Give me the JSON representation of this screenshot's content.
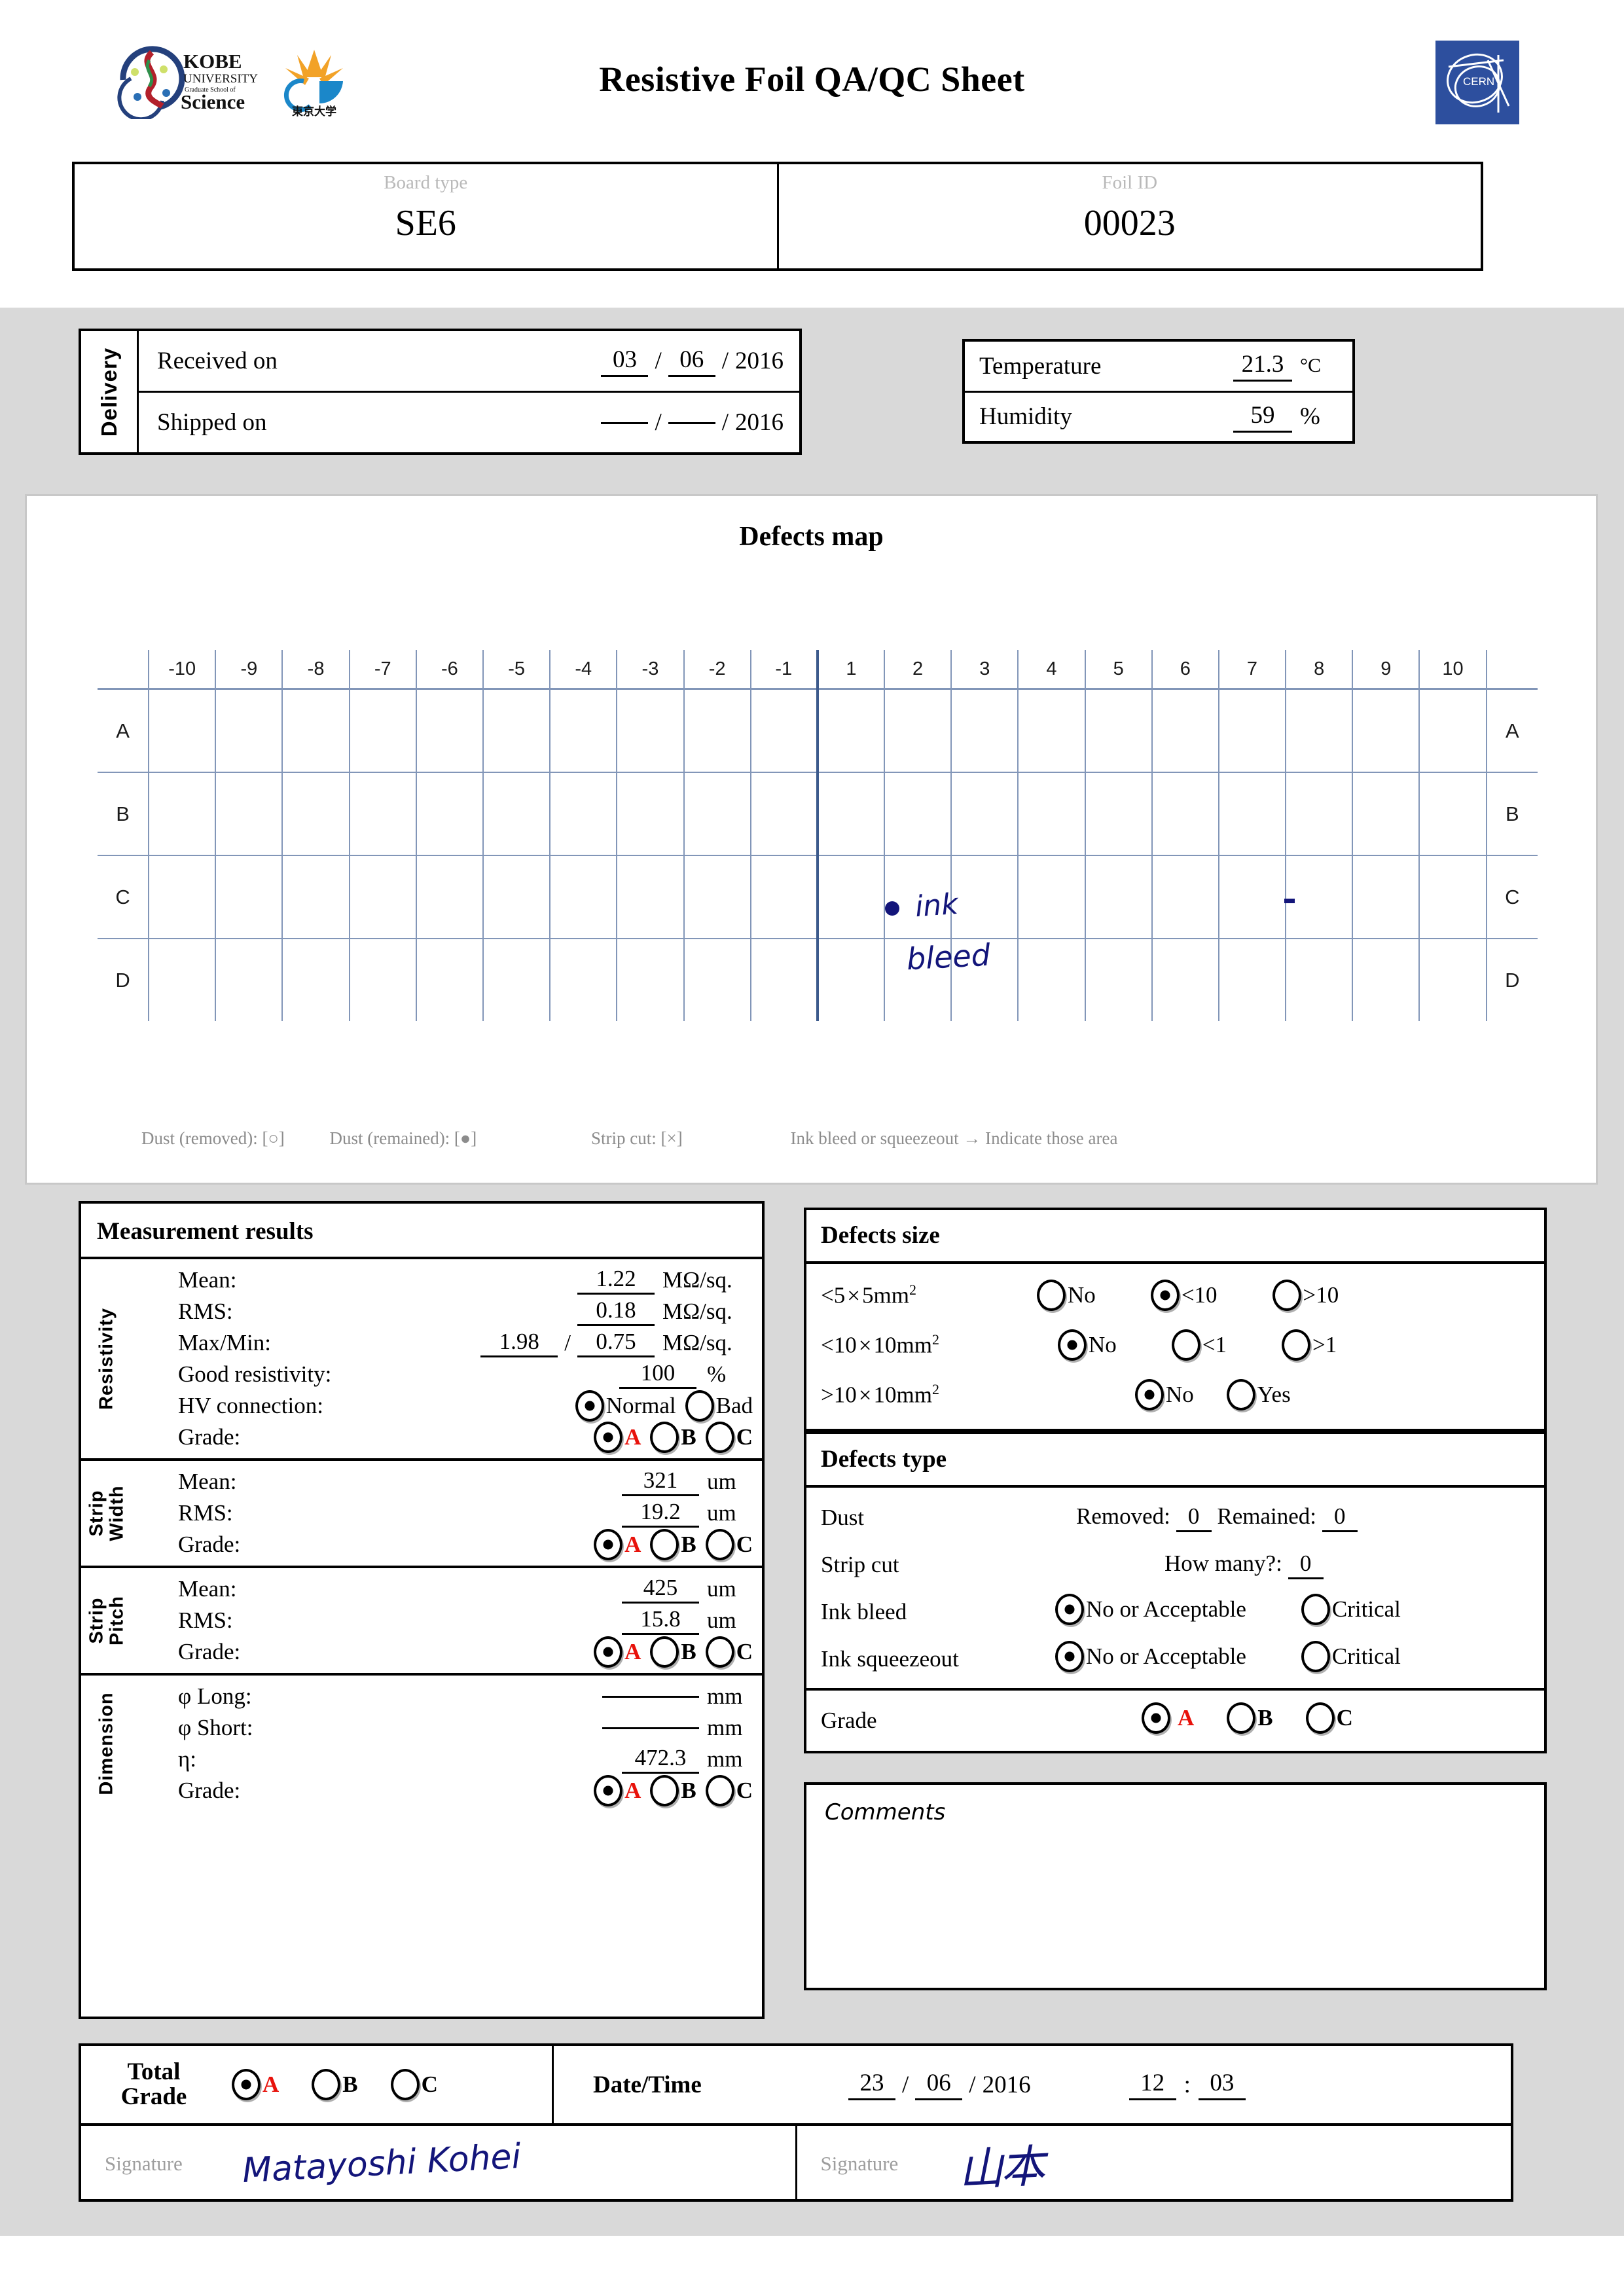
{
  "header": {
    "title": "Resistive Foil QA/QC Sheet",
    "logos": {
      "kobe": "KOBE UNIVERSITY Graduate School of Science",
      "tokyo": "東京大学 THE UNIVERSITY OF TOKYO",
      "cern": "CERN"
    }
  },
  "identity": {
    "board_type_label": "Board type",
    "board_type_value": "SE6",
    "foil_id_label": "Foil ID",
    "foil_id_value": "00023"
  },
  "delivery": {
    "section_label": "Delivery",
    "received_label": "Received on",
    "received_day": "03",
    "received_month": "06",
    "received_year": "2016",
    "shipped_label": "Shipped on",
    "shipped_day": "",
    "shipped_month": "",
    "shipped_year": "2016"
  },
  "environment": {
    "temperature_label": "Temperature",
    "temperature_value": "21.3",
    "temperature_unit": "°C",
    "humidity_label": "Humidity",
    "humidity_value": "59",
    "humidity_unit": "%"
  },
  "defects_map": {
    "title": "Defects map",
    "columns": [
      "-10",
      "-9",
      "-8",
      "-7",
      "-6",
      "-5",
      "-4",
      "-3",
      "-2",
      "-1",
      "1",
      "2",
      "3",
      "4",
      "5",
      "6",
      "7",
      "8",
      "9",
      "10"
    ],
    "rows": [
      "A",
      "B",
      "C",
      "D"
    ],
    "annotations": [
      {
        "type": "dot-marker",
        "text": "",
        "row": "C",
        "column": "1"
      },
      {
        "type": "handwriting",
        "text": "ink",
        "row": "C",
        "column": "1"
      },
      {
        "type": "handwriting",
        "text": "bleed",
        "row": "C",
        "column": "1"
      },
      {
        "type": "dash-marker",
        "text": "",
        "row": "C",
        "column": "7"
      }
    ],
    "legend": {
      "dust_removed": "Dust (removed): [○]",
      "dust_remained": "Dust (remained): [●]",
      "strip_cut": "Strip cut: [×]",
      "ink_bleed": "Ink bleed or squeezeout → Indicate those area"
    }
  },
  "measurement_results": {
    "title": "Measurement results",
    "resistivity": {
      "label": "Resistivity",
      "mean_label": "Mean:",
      "mean_value": "1.22",
      "mean_unit": "MΩ/sq.",
      "rms_label": "RMS:",
      "rms_value": "0.18",
      "rms_unit": "MΩ/sq.",
      "maxmin_label": "Max/Min:",
      "max_value": "1.98",
      "min_value": "0.75",
      "maxmin_unit": "MΩ/sq.",
      "good_label": "Good resistivity:",
      "good_value": "100",
      "good_unit": "%",
      "hv_label": "HV connection:",
      "hv_options": [
        "Normal",
        "Bad"
      ],
      "hv_selected": "Normal",
      "grade_label": "Grade:",
      "grade_options": [
        "A",
        "B",
        "C"
      ],
      "grade_selected": "A"
    },
    "strip_width": {
      "label": "Strip Width",
      "mean_label": "Mean:",
      "mean_value": "321",
      "mean_unit": "um",
      "rms_label": "RMS:",
      "rms_value": "19.2",
      "rms_unit": "um",
      "grade_label": "Grade:",
      "grade_options": [
        "A",
        "B",
        "C"
      ],
      "grade_selected": "A"
    },
    "strip_pitch": {
      "label": "Strip Pitch",
      "mean_label": "Mean:",
      "mean_value": "425",
      "mean_unit": "um",
      "rms_label": "RMS:",
      "rms_value": "15.8",
      "rms_unit": "um",
      "grade_label": "Grade:",
      "grade_options": [
        "A",
        "B",
        "C"
      ],
      "grade_selected": "A"
    },
    "dimension": {
      "label": "Dimension",
      "phi_long_label": "φ Long:",
      "phi_long_value": "",
      "phi_long_unit": "mm",
      "phi_short_label": "φ Short:",
      "phi_short_value": "",
      "phi_short_unit": "mm",
      "eta_label": "η:",
      "eta_value": "472.3",
      "eta_unit": "mm",
      "grade_label": "Grade:",
      "grade_options": [
        "A",
        "B",
        "C"
      ],
      "grade_selected": "A"
    }
  },
  "defects_size": {
    "title": "Defects size",
    "rows": [
      {
        "label_main": "<5",
        "label_cross": "×",
        "label_rest": "5mm",
        "sup": "2",
        "options": [
          "No",
          "<10",
          ">10"
        ],
        "selected": "<10"
      },
      {
        "label_main": "<10",
        "label_cross": "×",
        "label_rest": "10mm",
        "sup": "2",
        "options": [
          "No",
          "<1",
          ">1"
        ],
        "selected": "No"
      },
      {
        "label_main": ">10",
        "label_cross": "×",
        "label_rest": "10mm",
        "sup": "2",
        "options": [
          "No",
          "Yes"
        ],
        "selected": "No"
      }
    ]
  },
  "defects_type": {
    "title": "Defects type",
    "dust_label": "Dust",
    "dust_removed_label": "Removed:",
    "dust_removed_value": "0",
    "dust_remained_label": "Remained:",
    "dust_remained_value": "0",
    "strip_cut_label": "Strip cut",
    "strip_cut_howmany_label": "How many?:",
    "strip_cut_howmany_value": "0",
    "ink_bleed_label": "Ink bleed",
    "ink_bleed_options": [
      "No or Acceptable",
      "Critical"
    ],
    "ink_bleed_selected": "No or Acceptable",
    "ink_squeezeout_label": "Ink squeezeout",
    "ink_squeezeout_options": [
      "No or Acceptable",
      "Critical"
    ],
    "ink_squeezeout_selected": "No or Acceptable",
    "grade_label": "Grade",
    "grade_options": [
      "A",
      "B",
      "C"
    ],
    "grade_selected": "A"
  },
  "comments": {
    "label": "Comments",
    "value": ""
  },
  "footer": {
    "total_grade_label_line1": "Total",
    "total_grade_label_line2": "Grade",
    "total_grade_options": [
      "A",
      "B",
      "C"
    ],
    "total_grade_selected": "A",
    "datetime_label": "Date/Time",
    "date_day": "23",
    "date_month": "06",
    "date_year": "2016",
    "time_hour": "12",
    "time_minute": "03",
    "signature_label_left": "Signature",
    "signature_value_left": "Matayoshi Kohei",
    "signature_label_right": "Signature",
    "signature_value_right": "山本"
  },
  "colors": {
    "grade_a_red": "#e8120b",
    "grid_blue": "#8296b8",
    "center_line_blue": "#3c5a8c",
    "handwriting_ink": "#13157a",
    "page_grey": "#d9d9d9",
    "cern_blue": "#2d4f9e"
  }
}
